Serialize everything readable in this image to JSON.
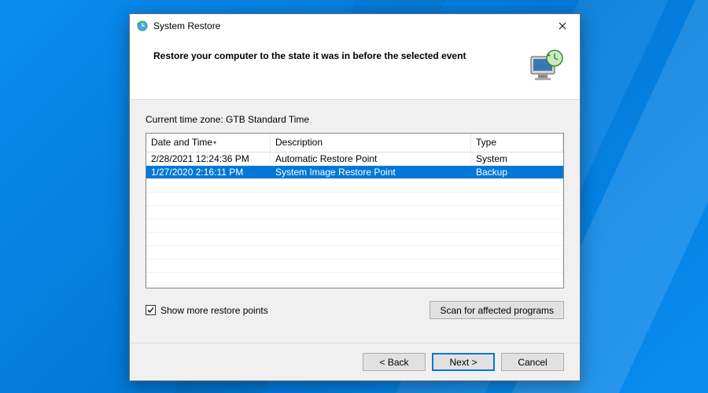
{
  "window": {
    "title": "System Restore"
  },
  "header": {
    "text": "Restore your computer to the state it was in before the selected event"
  },
  "timezone": {
    "label": "Current time zone: GTB Standard Time"
  },
  "columns": {
    "date": "Date and Time",
    "desc": "Description",
    "type": "Type"
  },
  "rows": [
    {
      "date": "2/28/2021 12:24:36 PM",
      "desc": "Automatic Restore Point",
      "type": "System",
      "selected": false
    },
    {
      "date": "1/27/2020 2:16:11 PM",
      "desc": "System Image Restore Point",
      "type": "Backup",
      "selected": true
    }
  ],
  "showMore": {
    "label": "Show more restore points",
    "checked": true
  },
  "scanButton": "Scan for affected programs",
  "footer": {
    "back": "< Back",
    "next": "Next >",
    "cancel": "Cancel"
  },
  "colors": {
    "selection": "#0078d7"
  }
}
